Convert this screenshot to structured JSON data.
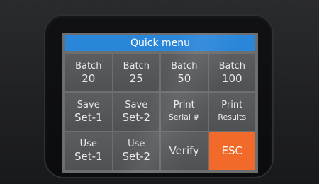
{
  "menu": {
    "title": "Quick menu",
    "buttons": [
      {
        "line1": "Batch",
        "line2": "20"
      },
      {
        "line1": "Batch",
        "line2": "25"
      },
      {
        "line1": "Batch",
        "line2": "50"
      },
      {
        "line1": "Batch",
        "line2": "100"
      },
      {
        "line1": "Save",
        "line2": "Set-1"
      },
      {
        "line1": "Save",
        "line2": "Set-2"
      },
      {
        "line1": "Print",
        "line2": "Serial #"
      },
      {
        "line1": "Print",
        "line2": "Results"
      },
      {
        "line1": "Use",
        "line2": "Set-1"
      },
      {
        "line1": "Use",
        "line2": "Set-2"
      },
      {
        "line1": "Verify"
      },
      {
        "line1": "ESC"
      }
    ]
  },
  "colors": {
    "header": "#2a86d9",
    "button": "#5c5d60",
    "esc": "#f26a2a",
    "screen_background": "#6d6e70"
  }
}
